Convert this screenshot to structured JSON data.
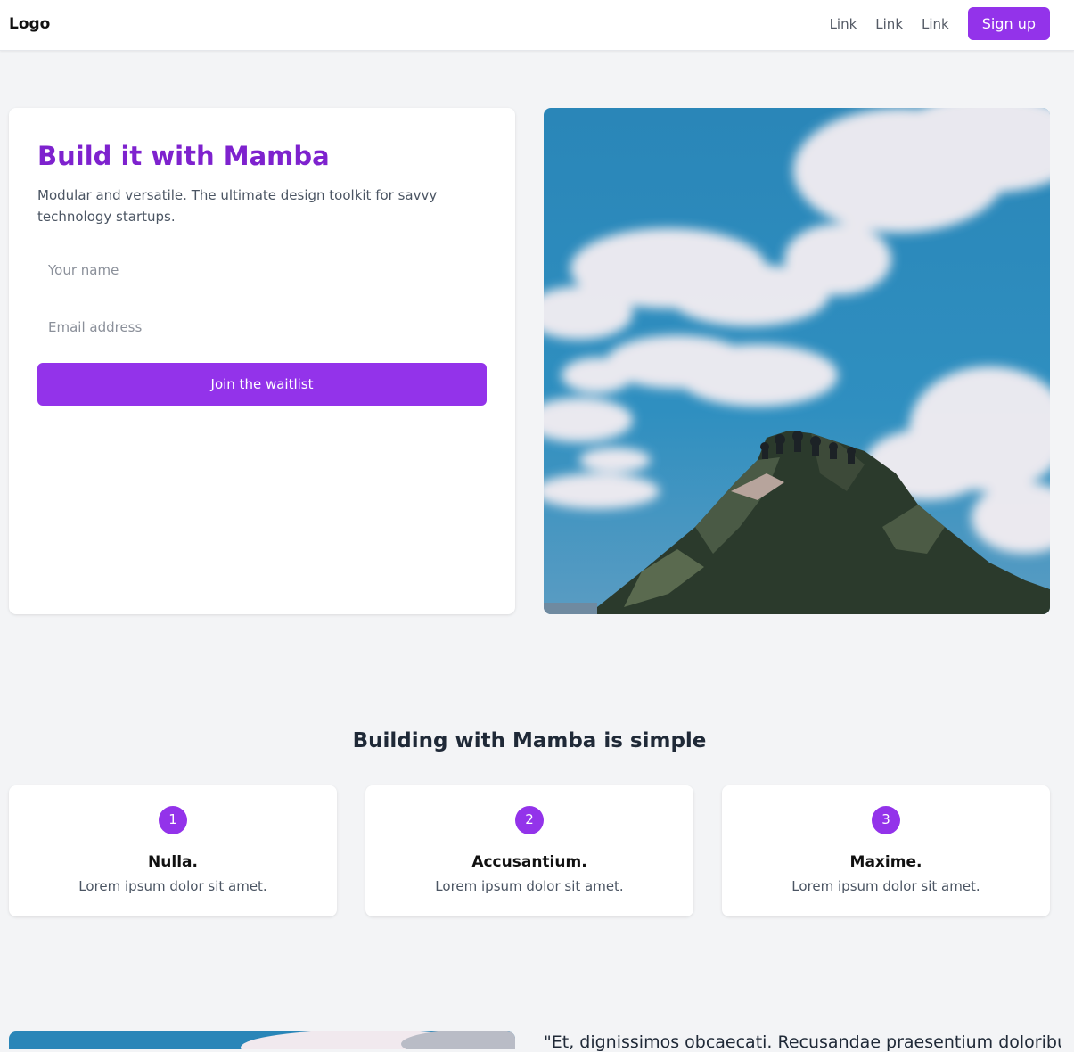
{
  "navbar": {
    "logo": "Logo",
    "links": [
      "Link",
      "Link",
      "Link"
    ],
    "signup_label": "Sign up"
  },
  "hero": {
    "title": "Build it with Mamba",
    "subtitle": "Modular and versatile. The ultimate design toolkit for savvy technology startups.",
    "name_placeholder": "Your name",
    "email_placeholder": "Email address",
    "cta_label": "Join the waitlist",
    "image_subject": "mountain-peak-under-cloudy-sky"
  },
  "steps": {
    "title": "Building with Mamba is simple",
    "items": [
      {
        "number": "1",
        "heading": "Nulla.",
        "text": "Lorem ipsum dolor sit amet."
      },
      {
        "number": "2",
        "heading": "Accusantium.",
        "text": "Lorem ipsum dolor sit amet."
      },
      {
        "number": "3",
        "heading": "Maxime.",
        "text": "Lorem ipsum dolor sit amet."
      }
    ]
  },
  "testimonial": {
    "quote": "\"Et, dignissimos obcaecati. Recusandae praesentium doloribus"
  },
  "colors": {
    "accent": "#9333ea",
    "title": "#7e22ce",
    "page_background": "#f3f4f6"
  }
}
